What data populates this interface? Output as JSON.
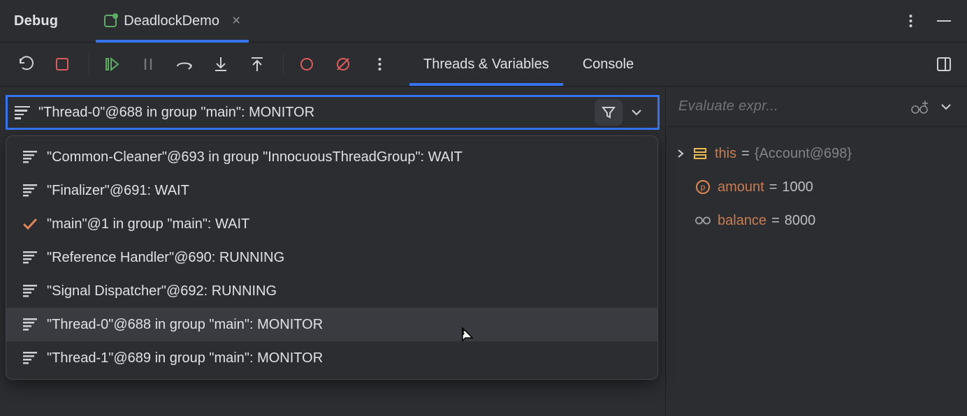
{
  "header": {
    "title": "Debug",
    "tab_label": "DeadlockDemo"
  },
  "toolbar": {
    "tab_threads": "Threads & Variables",
    "tab_console": "Console"
  },
  "currentThread": "\"Thread-0\"@688 in group \"main\": MONITOR",
  "threads": [
    {
      "icon": "stack",
      "label": "\"Common-Cleaner\"@693 in group \"InnocuousThreadGroup\": WAIT"
    },
    {
      "icon": "stack",
      "label": "\"Finalizer\"@691: WAIT"
    },
    {
      "icon": "check",
      "label": "\"main\"@1 in group \"main\": WAIT"
    },
    {
      "icon": "stack",
      "label": "\"Reference Handler\"@690: RUNNING"
    },
    {
      "icon": "stack",
      "label": "\"Signal Dispatcher\"@692: RUNNING"
    },
    {
      "icon": "stack",
      "label": "\"Thread-0\"@688 in group \"main\": MONITOR",
      "hover": true
    },
    {
      "icon": "stack",
      "label": "\"Thread-1\"@689 in group \"main\": MONITOR"
    }
  ],
  "evaluate": {
    "placeholder": "Evaluate expr..."
  },
  "variables": [
    {
      "kind": "object",
      "name": "this",
      "value": "{Account@698}",
      "expandable": true
    },
    {
      "kind": "param",
      "name": "amount",
      "value": "1000"
    },
    {
      "kind": "watch",
      "name": "balance",
      "value": "8000"
    }
  ]
}
